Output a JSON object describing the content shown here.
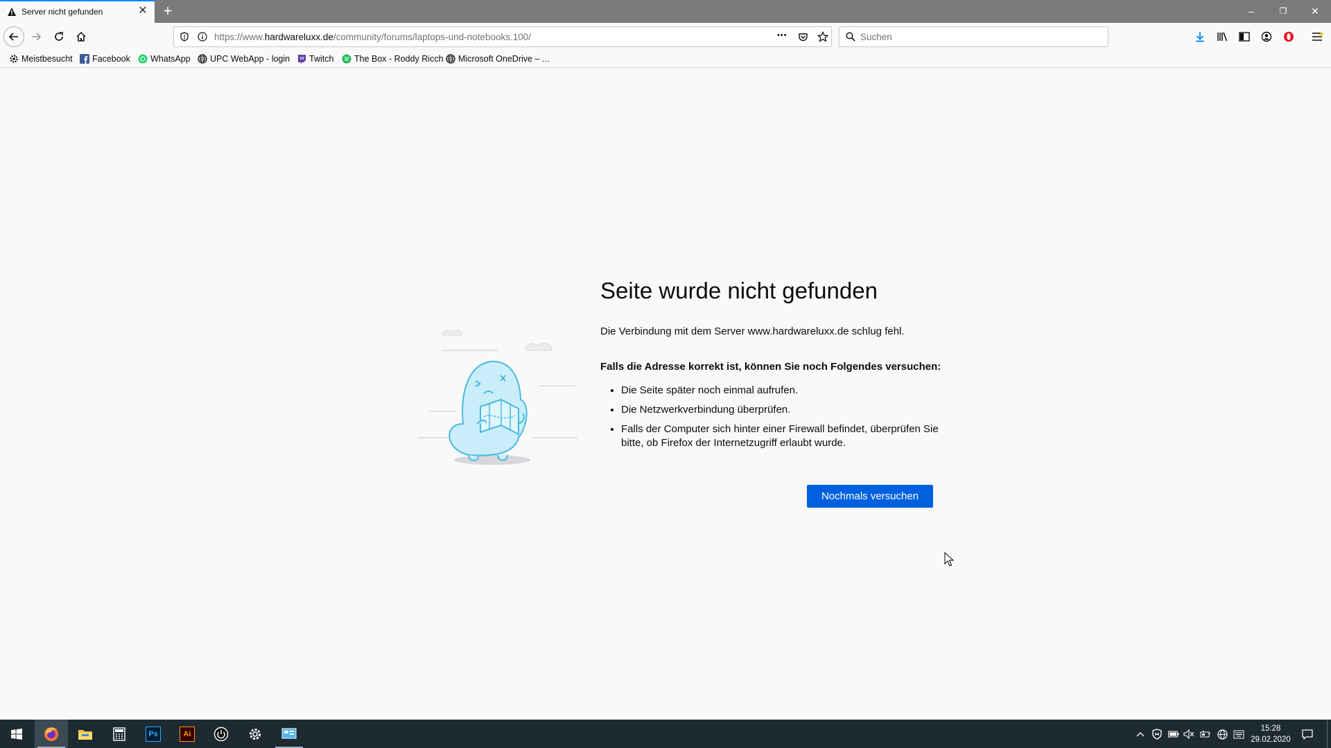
{
  "tab": {
    "title": "Server nicht gefunden",
    "close": "✕",
    "new_tab": "+"
  },
  "window_controls": {
    "minimize": "–",
    "restore": "❐",
    "close": "✕"
  },
  "url": {
    "prefix": "https://www.",
    "host": "hardwareluxx.de",
    "path": "/community/forums/laptops-und-notebooks.100/",
    "more": "•••"
  },
  "search": {
    "placeholder": "Suchen"
  },
  "bookmarks": [
    {
      "label": "Meistbesucht",
      "icon": "gear-icon"
    },
    {
      "label": "Facebook",
      "icon": "facebook-icon"
    },
    {
      "label": "WhatsApp",
      "icon": "whatsapp-icon"
    },
    {
      "label": "UPC WebApp - login",
      "icon": "globe-icon"
    },
    {
      "label": "Twitch",
      "icon": "twitch-icon"
    },
    {
      "label": "The Box - Roddy Ricch",
      "icon": "spotify-icon"
    },
    {
      "label": "Microsoft OneDrive – ...",
      "icon": "globe-icon"
    }
  ],
  "error": {
    "title": "Seite wurde nicht gefunden",
    "short": "Die Verbindung mit dem Server www.hardwareluxx.de schlug fehl.",
    "hint": "Falls die Adresse korrekt ist, können Sie noch Folgendes versuchen:",
    "items": [
      "Die Seite später noch einmal aufrufen.",
      "Die Netzwerkverbindung überprüfen.",
      "Falls der Computer sich hinter einer Firewall befindet, überprüfen Sie bitte, ob Firefox der Internetzugriff erlaubt wurde."
    ],
    "retry_label": "Nochmals versuchen"
  },
  "taskbar": {
    "apps": [
      "windows-start",
      "firefox",
      "file-explorer",
      "calculator",
      "photoshop",
      "illustrator",
      "power-app",
      "settings",
      "control-panel"
    ],
    "ps_label": "Ps",
    "ai_label": "Ai",
    "clock_time": "15:28",
    "clock_date": "29.02.2020"
  },
  "colors": {
    "accent": "#0060df",
    "tab_highlight": "#0a84ff",
    "taskbar": "#1d2a32"
  }
}
